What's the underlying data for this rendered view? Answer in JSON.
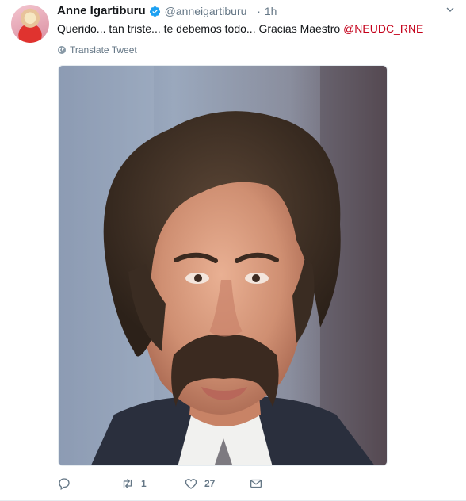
{
  "tweet": {
    "display_name": "Anne Igartiburu",
    "handle": "@anneigartiburu_",
    "separator": "·",
    "time": "1h",
    "text_main": "Querido... tan triste... te debemos todo... Gracias Maestro ",
    "mention": "@NEUDC_RNE",
    "translate_label": "Translate Tweet",
    "verified_icon": "verified-badge-icon",
    "media_icon": "photo-of-man-with-mustache"
  },
  "actions": {
    "reply_count": "",
    "retweet_count": "1",
    "like_count": "27"
  },
  "colors": {
    "link": "#c4001a",
    "muted": "#657786",
    "verified": "#1da1f2"
  }
}
